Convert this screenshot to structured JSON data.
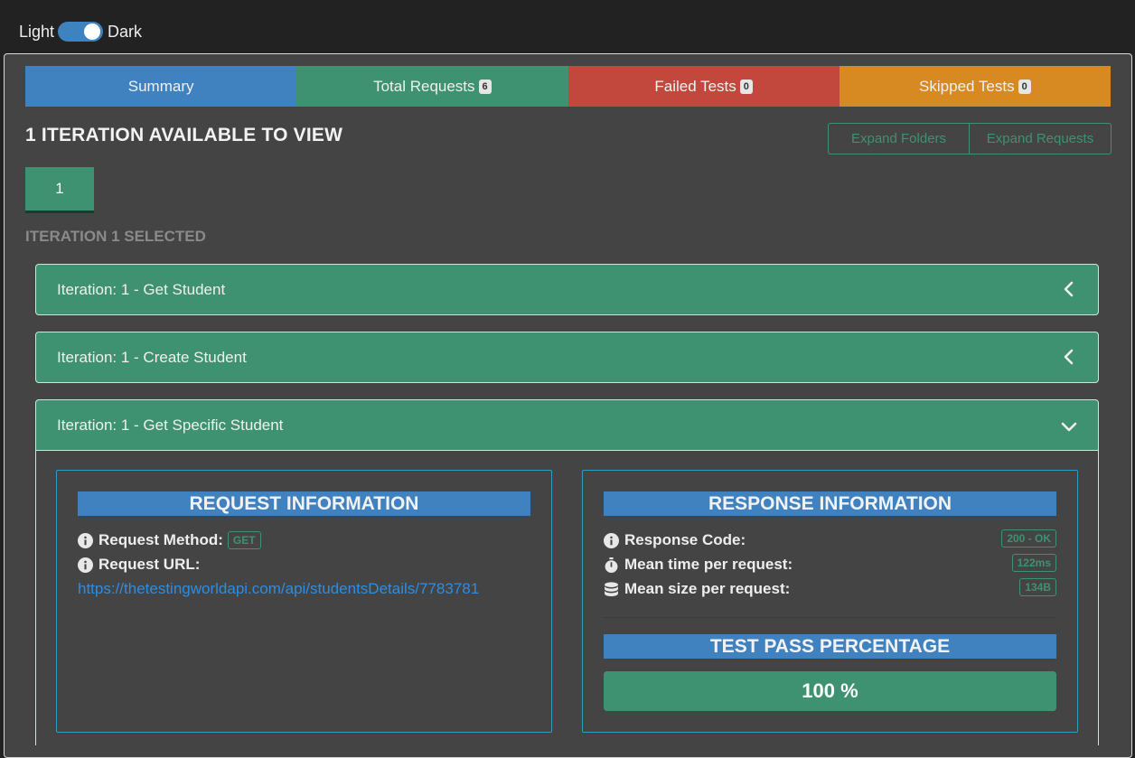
{
  "theme": {
    "light_label": "Light",
    "dark_label": "Dark",
    "mode": "dark"
  },
  "tabs": {
    "summary": {
      "label": "Summary"
    },
    "total": {
      "label": "Total Requests",
      "count": "6"
    },
    "failed": {
      "label": "Failed Tests",
      "count": "0"
    },
    "skipped": {
      "label": "Skipped Tests",
      "count": "0"
    }
  },
  "iterations": {
    "heading": "1 ITERATION AVAILABLE TO VIEW",
    "expand_folders": "Expand Folders",
    "expand_requests": "Expand Requests",
    "pills": [
      "1"
    ],
    "selected_label": "ITERATION 1 SELECTED"
  },
  "requests": [
    {
      "title": "Iteration: 1 - Get Student",
      "state": "collapsed"
    },
    {
      "title": "Iteration: 1 - Create Student",
      "state": "collapsed"
    },
    {
      "title": "Iteration: 1 - Get Specific Student",
      "state": "expanded"
    }
  ],
  "request_info": {
    "title": "REQUEST INFORMATION",
    "method_label": "Request Method:",
    "method": "GET",
    "url_label": "Request URL:",
    "url": "https://thetestingworldapi.com/api/studentsDetails/7783781"
  },
  "response_info": {
    "title": "RESPONSE INFORMATION",
    "code_label": "Response Code:",
    "code": "200 - OK",
    "mean_time_label": "Mean time per request:",
    "mean_time": "122ms",
    "mean_size_label": "Mean size per request:",
    "mean_size": "134B",
    "pass_title": "TEST PASS PERCENTAGE",
    "pass_percent": 100,
    "pass_text": "100 %"
  },
  "icons": {
    "info": "info-circle-icon",
    "timer": "stopwatch-icon",
    "size": "database-icon",
    "chevron_collapsed": "chevron-left-icon",
    "chevron_expanded": "chevron-down-icon"
  },
  "colors": {
    "summary": "#3f82bf",
    "success": "#3e9171",
    "danger": "#c2483d",
    "warning": "#d68a21",
    "link": "#2e8de0"
  }
}
